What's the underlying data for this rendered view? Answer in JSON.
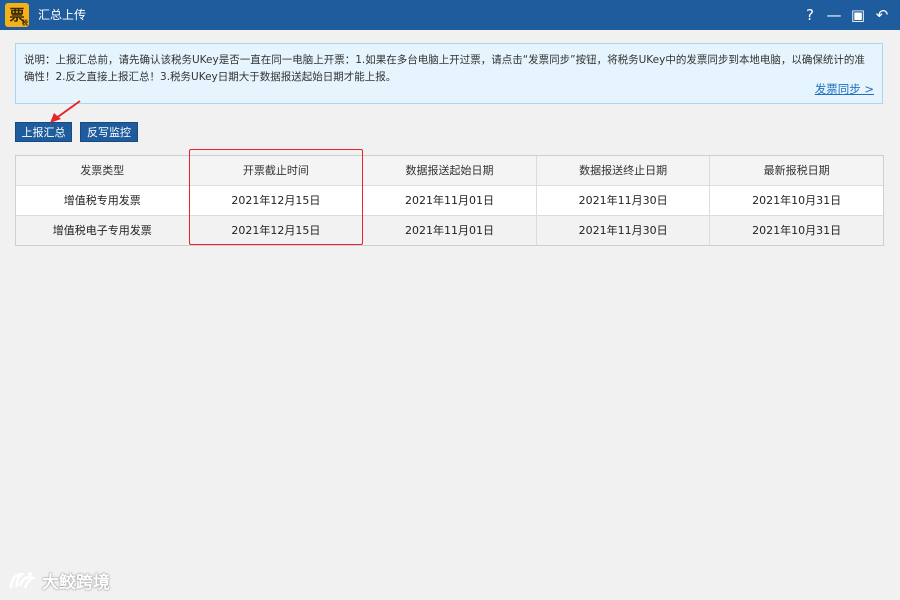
{
  "app": {
    "logo_char": "票",
    "logo_small": "税",
    "window_title": "汇总上传",
    "window_buttons": [
      "?",
      "—",
      "▣",
      "↶"
    ]
  },
  "notice": {
    "text": "说明：上报汇总前，请先确认该税务UKey是否一直在同一电脑上开票：1.如果在多台电脑上开过票，请点击“发票同步”按钮，将税务UKey中的发票同步到本地电脑，以确保统计的准确性！2.反之直接上报汇总！3.税务UKey日期大于数据报送起始日期才能上报。",
    "sync_link": "发票同步 >"
  },
  "toolbar": {
    "report_label": "上报汇总",
    "monitor_label": "反写监控"
  },
  "table": {
    "headers": [
      "发票类型",
      "开票截止时间",
      "数据报送起始日期",
      "数据报送终止日期",
      "最新报税日期"
    ],
    "rows": [
      [
        "增值税专用发票",
        "2021年12月15日",
        "2021年11月01日",
        "2021年11月30日",
        "2021年10月31日"
      ],
      [
        "增值税电子专用发票",
        "2021年12月15日",
        "2021年11月01日",
        "2021年11月30日",
        "2021年10月31日"
      ]
    ]
  },
  "watermark": {
    "text": "大鲛跨境"
  },
  "colors": {
    "titlebar": "#1f5c9d",
    "highlight": "#e5252b",
    "notice_bg": "#e5f4fd",
    "link": "#1e70c1"
  }
}
